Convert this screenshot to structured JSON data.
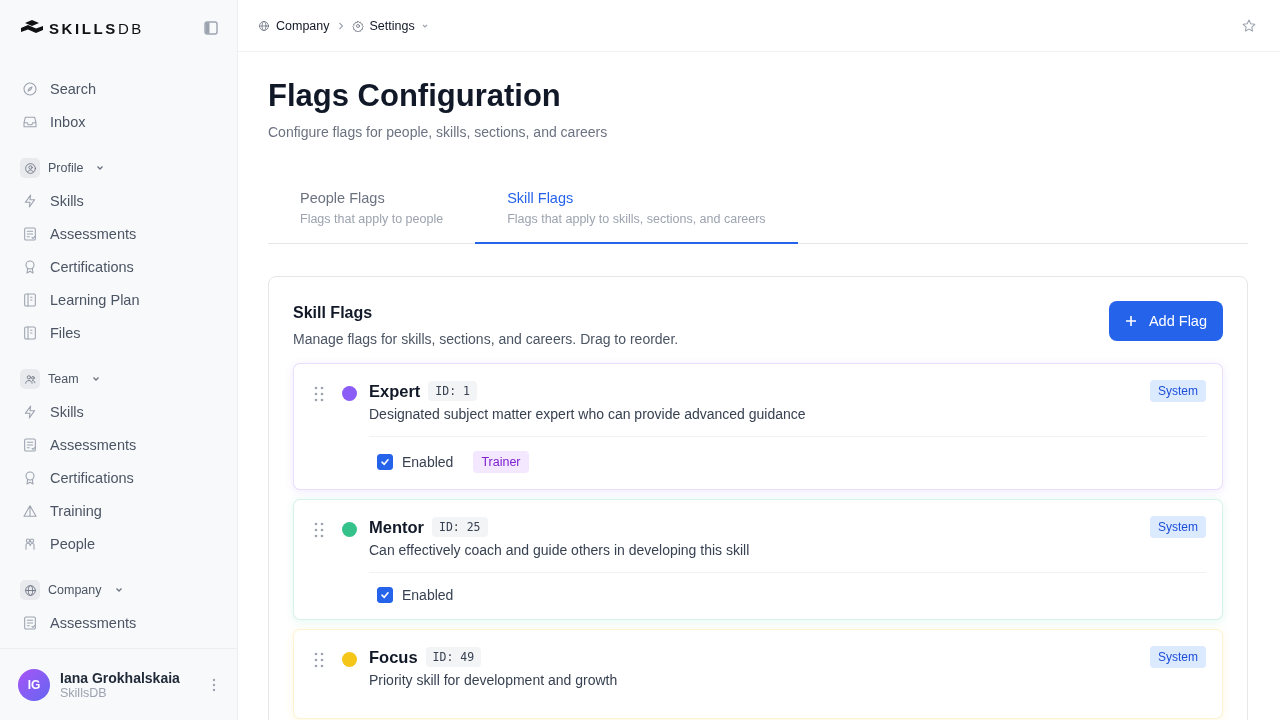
{
  "sidebar": {
    "logo": "**SKILLS**DB",
    "top_items": [
      "Search",
      "Inbox"
    ],
    "sections": [
      {
        "label": "Profile",
        "expanded": true,
        "items": [
          "Skills",
          "Assessments",
          "Certifications",
          "Learning Plan",
          "Files"
        ]
      },
      {
        "label": "Team",
        "expanded": true,
        "items": [
          "Skills",
          "Assessments",
          "Certifications",
          "Training",
          "People"
        ]
      },
      {
        "label": "Company",
        "expanded": true,
        "items": [
          "Assessments"
        ]
      }
    ],
    "user": {
      "initials": "IG",
      "name": "Iana Grokhalskaia",
      "org": "SkillsDB"
    }
  },
  "breadcrumb": [
    "Company",
    "Settings"
  ],
  "page": {
    "title": "Flags Configuration",
    "subtitle": "Configure flags for people, skills, sections, and careers"
  },
  "tabs": [
    {
      "label": "People Flags",
      "description": "Flags that apply to people",
      "selected": false
    },
    {
      "label": "Skill Flags",
      "description": "Flags that apply to skills, sections, and careers",
      "selected": true
    }
  ],
  "panel": {
    "title": "Skill Flags",
    "subtitle": "Manage flags for skills, sections, and careers. Drag to reorder.",
    "add_button": "Add Flag"
  },
  "flags": [
    {
      "name": "Expert",
      "id": "ID: 1",
      "color": "#8b5cf6",
      "description": "Designated subject matter expert who can provide advanced guidance",
      "badge": "System",
      "enabled": true,
      "enabled_label": "Enabled",
      "tag": "Trainer"
    },
    {
      "name": "Mentor",
      "id": "ID: 25",
      "color": "#34c28a",
      "description": "Can effectively coach and guide others in developing this skill",
      "badge": "System",
      "enabled": true,
      "enabled_label": "Enabled"
    },
    {
      "name": "Focus",
      "id": "ID: 49",
      "color": "#f5c518",
      "description": "Priority skill for development and growth",
      "badge": "System"
    }
  ]
}
